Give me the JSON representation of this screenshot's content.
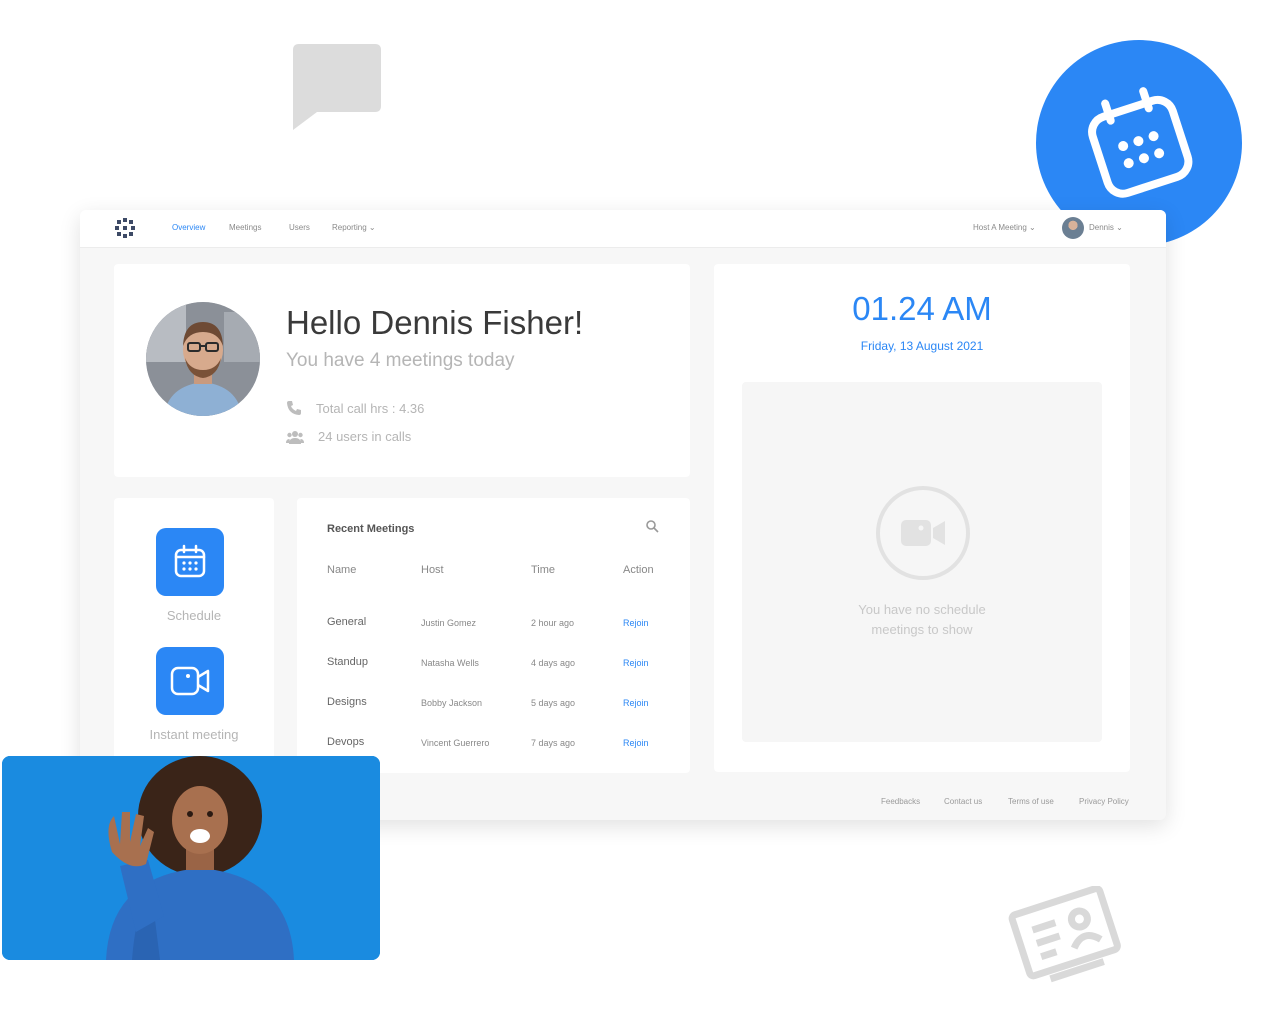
{
  "nav": {
    "items": [
      "Overview",
      "Meetings",
      "Users",
      "Reporting ⌄"
    ],
    "active": "Overview",
    "host_meeting": "Host A Meeting ⌄",
    "user_name": "Dennis ⌄"
  },
  "profile": {
    "greeting": "Hello Dennis Fisher!",
    "subtitle": "You have 4 meetings today",
    "call_hours": "Total call hrs : 4.36",
    "users_in_calls": "24 users in calls"
  },
  "clock": {
    "time": "01.24 AM",
    "date": "Friday, 13 August 2021",
    "empty_line1": "You have no schedule",
    "empty_line2": "meetings to show"
  },
  "actions": {
    "schedule": "Schedule",
    "instant": "Instant meeting"
  },
  "recent": {
    "title": "Recent Meetings",
    "columns": [
      "Name",
      "Host",
      "Time",
      "Action"
    ],
    "rows": [
      {
        "name": "General",
        "host": "Justin Gomez",
        "time": "2 hour ago",
        "action": "Rejoin"
      },
      {
        "name": "Standup",
        "host": "Natasha Wells",
        "time": "4 days ago",
        "action": "Rejoin"
      },
      {
        "name": "Designs",
        "host": "Bobby Jackson",
        "time": "5 days ago",
        "action": "Rejoin"
      },
      {
        "name": "Devops",
        "host": "Vincent Guerrero",
        "time": "7 days ago",
        "action": "Rejoin"
      }
    ]
  },
  "footer": [
    "Feedbacks",
    "Contact us",
    "Terms of use",
    "Privacy Policy"
  ],
  "colors": {
    "accent": "#2b87f5",
    "decor_gray": "#dcdcdc",
    "video_bg": "#1a8be0"
  },
  "icons": [
    "chat-bubble-icon",
    "calendar-icon",
    "contact-card-icon",
    "phone-icon",
    "users-icon",
    "video-camera-icon",
    "search-icon",
    "logo-icon"
  ]
}
